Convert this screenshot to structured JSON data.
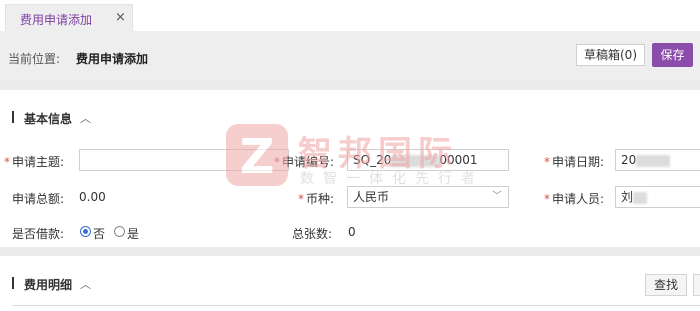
{
  "tab": {
    "title": "费用申请添加",
    "close": "×"
  },
  "header": {
    "crumb_label": "当前位置:",
    "crumb_value": "费用申请添加",
    "draft_button": "草稿箱(0)",
    "save_button": "保存"
  },
  "basic_section": {
    "title": "基本信息",
    "chevron": "︿",
    "required_mark": "*",
    "fields": {
      "subject": {
        "label": "申请主题:",
        "value": ""
      },
      "number": {
        "label": "申请编号:",
        "value": "SQ_20",
        "value_tail": "00001"
      },
      "date": {
        "label": "申请日期:",
        "value": "20"
      },
      "total": {
        "label": "申请总额:",
        "value": "0.00"
      },
      "currency": {
        "label": "币种:",
        "value": "人民币",
        "arrow": "﹀"
      },
      "applicant": {
        "label": "申请人员:",
        "value": "刘"
      },
      "loan": {
        "label": "是否借款:",
        "options": [
          "否",
          "是"
        ],
        "selected": "否"
      },
      "sheets": {
        "label": "总张数:",
        "value": "0"
      }
    }
  },
  "detail_section": {
    "title": "费用明细",
    "chevron": "︿",
    "search_button": "查找"
  },
  "watermark": {
    "logo_letter": "Z",
    "name": "智邦国际",
    "slogan": "数智一体化先行者"
  }
}
